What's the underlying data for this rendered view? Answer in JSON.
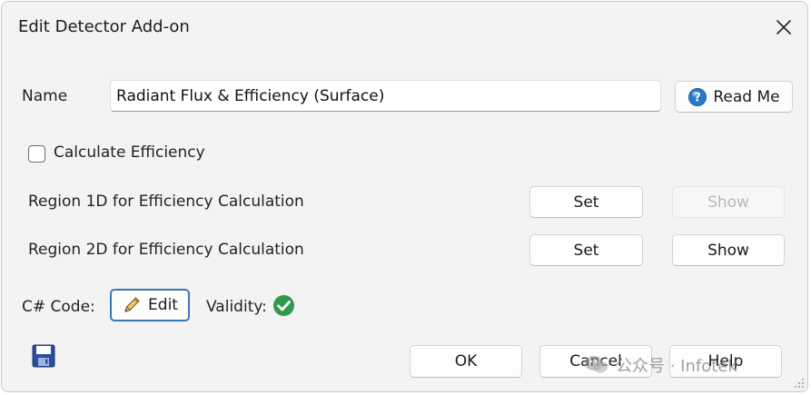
{
  "window": {
    "title": "Edit Detector Add-on"
  },
  "name_row": {
    "label": "Name",
    "value": "Radiant Flux & Efficiency (Surface)",
    "readme_label": "Read Me"
  },
  "calculate_efficiency": {
    "label": "Calculate Efficiency",
    "checked": false
  },
  "regions": [
    {
      "label": "Region 1D for Efficiency Calculation",
      "set_label": "Set",
      "show_label": "Show",
      "show_enabled": false
    },
    {
      "label": "Region 2D for Efficiency Calculation",
      "set_label": "Set",
      "show_label": "Show",
      "show_enabled": true
    }
  ],
  "code_row": {
    "label": "C# Code:",
    "edit_label": "Edit",
    "validity_label": "Validity:",
    "validity_status": "valid"
  },
  "footer": {
    "ok_label": "OK",
    "cancel_label": "Cancel",
    "help_label": "Help"
  },
  "watermark": {
    "text": "公众号 · Infotek"
  },
  "icons": {
    "close": "close-icon",
    "readme": "help-circle-icon",
    "edit": "pencil-icon",
    "validity": "check-circle-icon",
    "save": "save-disk-icon",
    "wechat": "wechat-icon"
  },
  "colors": {
    "accent": "#2a78c9",
    "valid": "#2f9a4a",
    "save_icon": "#2b4d9a"
  }
}
